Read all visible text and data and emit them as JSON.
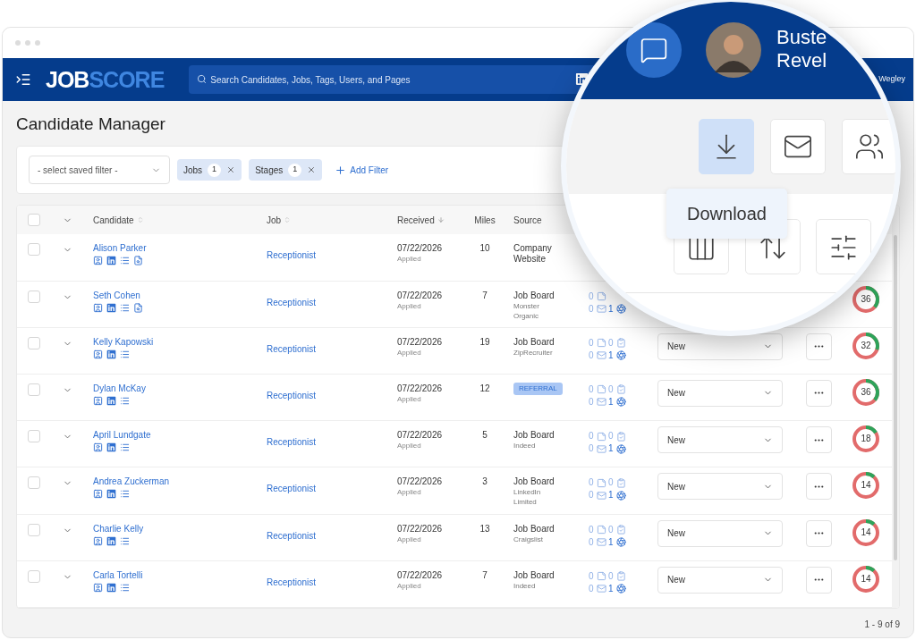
{
  "header": {
    "logo": {
      "primary": "JOB",
      "accent": "SCORE"
    },
    "search": {
      "placeholder": "Search Candidates, Jobs, Tags, Users, and Pages"
    },
    "user_name_fragment": "Wegley"
  },
  "page_title": "Candidate Manager",
  "filters": {
    "saved_filter": {
      "placeholder": "- select saved filter -"
    },
    "chips": [
      {
        "label": "Jobs",
        "count": "1"
      },
      {
        "label": "Stages",
        "count": "1"
      }
    ],
    "add_filter": "Add Filter"
  },
  "table": {
    "select_all": {
      "checked": false
    },
    "columns": [
      {
        "label": "Candidate",
        "sortable": true,
        "sorted_descending": false
      },
      {
        "label": "Job",
        "sortable": true,
        "sorted_descending": false
      },
      {
        "label": "Received",
        "sortable": true,
        "sorted_descending": true
      },
      {
        "label": "Miles",
        "sortable": false,
        "sorted_descending": false
      },
      {
        "label": "Source",
        "sortable": false,
        "sorted_descending": false
      }
    ],
    "rows": [
      {
        "name": "Alison Parker",
        "checked": false,
        "attachment": true,
        "job": "Receptionist",
        "received": "07/22/2026",
        "received_note": "Applied",
        "miles": "10",
        "source": {
          "kind": "text",
          "label": "Company Website"
        }
      },
      {
        "name": "Seth Cohen",
        "checked": false,
        "attachment": true,
        "job": "Receptionist",
        "received": "07/22/2026",
        "received_note": "Applied",
        "miles": "7",
        "source": {
          "kind": "text",
          "label": "Job Board",
          "detail": "Monster Organic"
        },
        "activity": [
          {
            "kind": "note",
            "count": "0"
          },
          {
            "kind": "email",
            "count": "0"
          },
          {
            "kind": "response",
            "count": "1"
          }
        ],
        "score": {
          "value": "36",
          "level": 0.36
        }
      },
      {
        "name": "Kelly Kapowski",
        "checked": false,
        "attachment": false,
        "job": "Receptionist",
        "received": "07/22/2026",
        "received_note": "Applied",
        "miles": "19",
        "source": {
          "kind": "text",
          "label": "Job Board",
          "detail": "ZipRecruiter"
        },
        "activity": [
          {
            "kind": "note",
            "count": "0"
          },
          {
            "kind": "task",
            "count": "0"
          },
          {
            "kind": "email",
            "count": "0"
          },
          {
            "kind": "response",
            "count": "1"
          }
        ],
        "stage": "New",
        "score": {
          "value": "32",
          "level": 0.3
        }
      },
      {
        "name": "Dylan McKay",
        "checked": false,
        "attachment": false,
        "job": "Receptionist",
        "received": "07/22/2026",
        "received_note": "Applied",
        "miles": "12",
        "source": {
          "kind": "badge",
          "label": "REFERRAL"
        },
        "activity": [
          {
            "kind": "note",
            "count": "0"
          },
          {
            "kind": "task",
            "count": "0"
          },
          {
            "kind": "email",
            "count": "0"
          },
          {
            "kind": "response",
            "count": "1"
          }
        ],
        "stage": "New",
        "score": {
          "value": "36",
          "level": 0.36
        }
      },
      {
        "name": "April Lundgate",
        "checked": false,
        "attachment": false,
        "job": "Receptionist",
        "received": "07/22/2026",
        "received_note": "Applied",
        "miles": "5",
        "source": {
          "kind": "text",
          "label": "Job Board",
          "detail": "Indeed"
        },
        "activity": [
          {
            "kind": "note",
            "count": "0"
          },
          {
            "kind": "task",
            "count": "0"
          },
          {
            "kind": "email",
            "count": "0"
          },
          {
            "kind": "response",
            "count": "1"
          }
        ],
        "stage": "New",
        "score": {
          "value": "18",
          "level": 0.16
        }
      },
      {
        "name": "Andrea Zuckerman",
        "checked": false,
        "attachment": false,
        "job": "Receptionist",
        "received": "07/22/2026",
        "received_note": "Applied",
        "miles": "3",
        "source": {
          "kind": "text",
          "label": "Job Board",
          "detail": "LinkedIn Limited"
        },
        "activity": [
          {
            "kind": "note",
            "count": "0"
          },
          {
            "kind": "task",
            "count": "0"
          },
          {
            "kind": "email",
            "count": "0"
          },
          {
            "kind": "response",
            "count": "1"
          }
        ],
        "stage": "New",
        "score": {
          "value": "14",
          "level": 0.12
        }
      },
      {
        "name": "Charlie Kelly",
        "checked": false,
        "attachment": false,
        "job": "Receptionist",
        "received": "07/22/2026",
        "received_note": "Applied",
        "miles": "13",
        "source": {
          "kind": "text",
          "label": "Job Board",
          "detail": "Craigslist"
        },
        "activity": [
          {
            "kind": "note",
            "count": "0"
          },
          {
            "kind": "task",
            "count": "0"
          },
          {
            "kind": "email",
            "count": "0"
          },
          {
            "kind": "response",
            "count": "1"
          }
        ],
        "stage": "New",
        "score": {
          "value": "14",
          "level": 0.12
        }
      },
      {
        "name": "Carla Tortelli",
        "checked": false,
        "attachment": false,
        "job": "Receptionist",
        "received": "07/22/2026",
        "received_note": "Applied",
        "miles": "7",
        "source": {
          "kind": "text",
          "label": "Job Board",
          "detail": "Indeed"
        },
        "activity": [
          {
            "kind": "note",
            "count": "0"
          },
          {
            "kind": "task",
            "count": "0"
          },
          {
            "kind": "email",
            "count": "0"
          },
          {
            "kind": "response",
            "count": "1"
          }
        ],
        "stage": "New",
        "score": {
          "value": "14",
          "level": 0.12
        }
      }
    ]
  },
  "pagination": "1 - 9 of 9",
  "magnifier": {
    "user": {
      "first_name": "Buste",
      "last_name": "Revel"
    },
    "toolbar": [
      {
        "kind": "download",
        "selected": true
      },
      {
        "kind": "email",
        "selected": false
      },
      {
        "kind": "team",
        "selected": false
      }
    ],
    "tooltip": "Download",
    "view_buttons": [
      {
        "kind": "columns"
      },
      {
        "kind": "sort"
      },
      {
        "kind": "filters"
      }
    ]
  }
}
